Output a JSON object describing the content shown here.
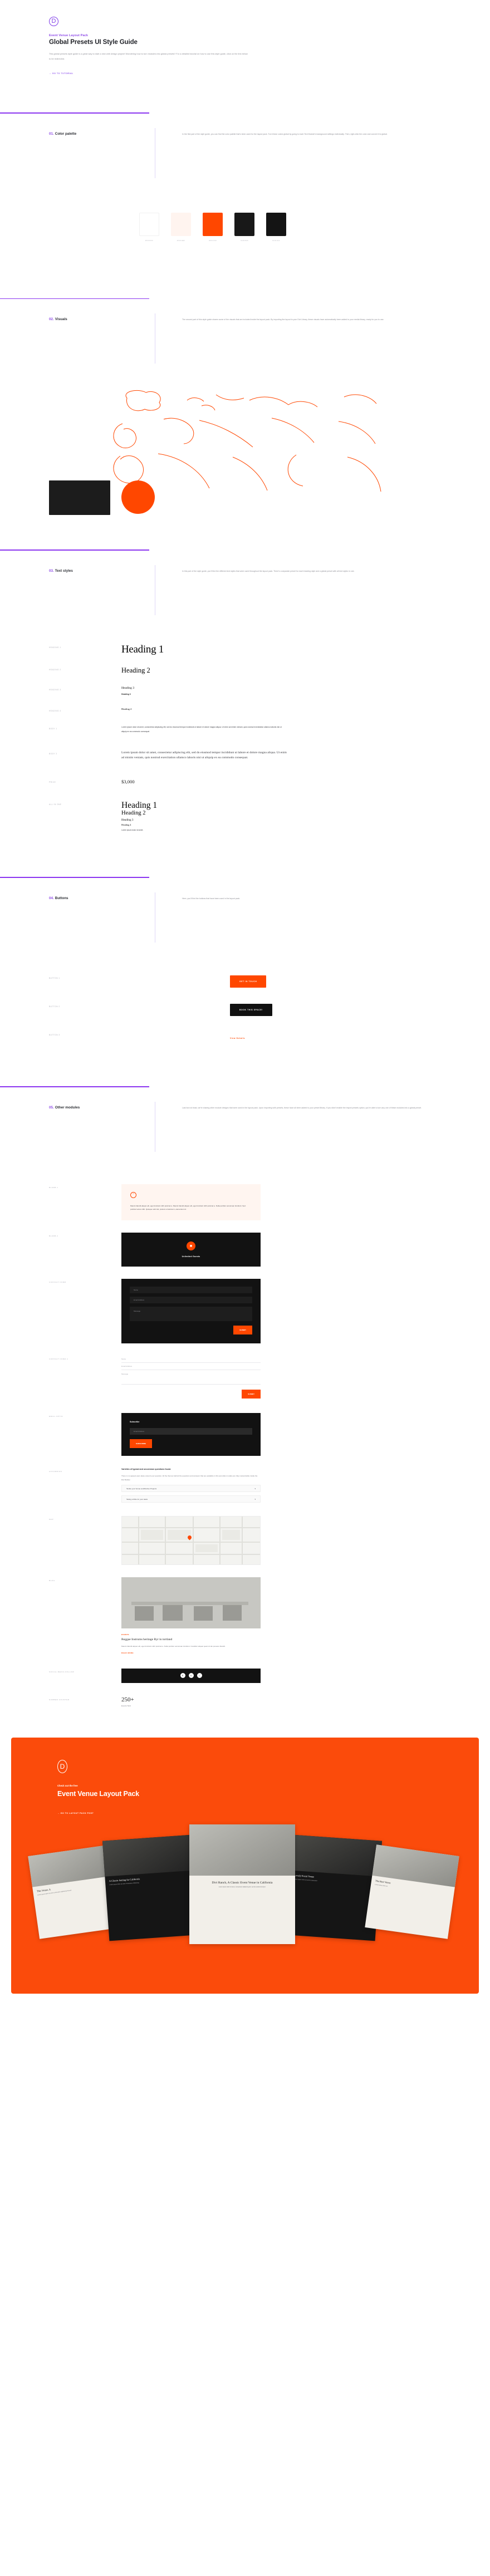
{
  "hero": {
    "logo_icon": "divi-d-logo",
    "eyebrow": "Event Venue Layout Pack",
    "title": "Global Presets UI Style Guide",
    "body": "This global presets style guide is a great way to start a new web design project! Wondering how to turn modules into global presets? For a detailed tutorial on how to use this style guide, click on the link below to be redirected.",
    "link": "→ GO TO TUTORIAL"
  },
  "sections": [
    {
      "num": "01.",
      "name": "Color palette",
      "desc": "In the first part of the style guide, you can find the color palette that's been used for the layout pack. Turn these colors global by going to each Text Module's background settings individually. Then, right-click the color and convert it to global."
    },
    {
      "num": "02.",
      "name": "Visuals",
      "desc": "The second part of this style guide shares some of the visuals that are included inside the layout pack. By importing the layout to your Divi Library, these visuals have automatically been added to your media library, ready for you to use."
    },
    {
      "num": "03.",
      "name": "Text styles",
      "desc": "In this part of the style guide, you'll find the different text styles that were used throughout the layout pack. There's a separate preset for each heading style and a global preset with all text styles in one."
    },
    {
      "num": "04.",
      "name": "Buttons",
      "desc": "Here, you'll find the buttons that have been used in the layout pack."
    },
    {
      "num": "05.",
      "name": "Other modules",
      "desc": "Last but not least, we're sharing other module designs that were used in the layout pack. Upon importing with presets, these have all been added to your preset library. If you didn't enable the import presets option, you're able to turn any one of these modules into a global preset."
    }
  ],
  "palette": [
    {
      "hex": "#FFFFFF",
      "label": "#FFFFFF",
      "bordered": true
    },
    {
      "hex": "#FFF4EF",
      "label": "#FFF4EF",
      "bordered": false
    },
    {
      "hex": "#FF4700",
      "label": "#FF4700",
      "bordered": false
    },
    {
      "hex": "#181818",
      "label": "#181818",
      "bordered": false
    },
    {
      "hex": "#141414",
      "label": "#141414",
      "bordered": false
    }
  ],
  "text_styles": {
    "h1_label": "HEADING 1",
    "h1_value": "Heading 1",
    "h2_label": "HEADING 2",
    "h2_value": "Heading 2",
    "h3_label": "HEADING 3",
    "h3_value": "Heading 3",
    "h3_bold_value": "Heading 3",
    "h4_label": "HEADING 4",
    "h4_value": "Heading 4",
    "body1_label": "BODY 1",
    "body1_value": "Lorem ipsum dolor sit amet, consectetur adipiscing elit, sed do eiusmod tempor incididunt ut labore et dolore magna aliqua. Ut enim ad minim veniam, quis nostrud exercitation ullamco laboris nisi ut aliquip ex ea commodo consequat.",
    "body2_label": "BODY 2",
    "body2_value": "Lorem ipsum dolor sit amet, consectetur adipiscing elit, sed do eiusmod tempor incididunt ut labore et dolore magna aliqua. Ut enim ad minim veniam, quis nostrud exercitation ullamco laboris nisi ut aliquip ex ea commodo consequat.",
    "price_label": "PRICE",
    "price_value": "$3,000",
    "allinone_label": "ALL IN ONE",
    "aio_h1": "Heading 1",
    "aio_h2": "Heading 2",
    "aio_h3": "Heading 3",
    "aio_h4": "Heading 4",
    "aio_p": "Lorem ipsum dolor sit amet."
  },
  "buttons": [
    {
      "label_tag": "BUTTON 1",
      "text": "GET IN TOUCH",
      "style": "solid-orange"
    },
    {
      "label_tag": "BUTTON 2",
      "text": "BOOK THIS SPACE!",
      "style": "solid-black"
    },
    {
      "label_tag": "BUTTON 3",
      "text": "View Details",
      "style": "text-orange"
    }
  ],
  "modules": {
    "blurb1": {
      "label": "BLURB 1",
      "icon": "quote-icon",
      "text": "Mauris blandit aliquet elit, eget tincidunt nibh pulvinar a. Mauris blandit aliquet elit, eget tincidunt nibh pulvinar a. Nulla porttitor accumsan tincidunt. Sed porttitor lectus nibh. Quisque velit nisl, pretium ut lacinia in, elementum id."
    },
    "blurb2": {
      "label": "BLURB 2",
      "icon": "calendar-icon",
      "title": "Unlimited Guests"
    },
    "contact_form": {
      "label": "CONTACT FORM",
      "name_placeholder": "Name",
      "email_placeholder": "Email Address",
      "message_placeholder": "Message",
      "submit_label": "SUBMIT"
    },
    "contact_form_2": {
      "label": "CONTACT FORM 2",
      "name_placeholder": "Name",
      "email_placeholder": "Email Address",
      "message_placeholder": "Message",
      "submit_label": "SUBMIT"
    },
    "email_optin": {
      "label": "EMAIL OPTIN",
      "title": "Subscribe",
      "field_placeholder": "Email Address",
      "button_label": "SUBSCRIBE"
    },
    "accordion": {
      "label": "ACCORDION",
      "title": "Varieties of typical and uncommon questions found.",
      "text": "There is no agreed-upon place around your question. All the themes behind the questions and answers that are available in this accordion module are fully customizable inside the Divi Builder.",
      "items": [
        "Tackle your Venue as Effective Projects",
        "Taking a Ride for your tasks"
      ]
    },
    "map": {
      "label": "MAP",
      "pin_icon": "map-pin-icon"
    },
    "blog": {
      "label": "BLOG",
      "meta": "EVENTS",
      "title": "Reggae Instrums heritage Ryr in tortland",
      "body": "Mauris blandit aliquet elit, eget tincidunt nibh pulvinar a. Nulla porttitor accumsan tincidunt. Curabitur aliquet quam id dui posuere blandit.",
      "more": "READ MORE"
    },
    "social": {
      "label": "SOCIAL MEDIA FOLLOW",
      "icons": [
        "facebook-icon",
        "twitter-icon",
        "instagram-icon"
      ]
    },
    "counter": {
      "label": "NUMBER COUNTER",
      "number": "250+",
      "caption": "Events Held"
    }
  },
  "cta": {
    "logo_icon": "divi-d-logo",
    "eyebrow": "Check out the free",
    "title": "Event Venue Layout Pack",
    "link": "→ GO TO LAYOUT PACK POST",
    "cards": [
      {
        "title": "This Venue, A",
        "body": "Lorem ipsum dolor sit amet consectetur adipiscing elit sed."
      },
      {
        "title": "A Classic Setting for California",
        "body": "Lorem ipsum dolor sit amet consectetur adipiscing."
      },
      {
        "title": "Divi Ranch, A Classic Event Venue in California",
        "body": "Lorem ipsum dolor sit amet, consectetur adipiscing elit, sed do eiusmod tempor."
      },
      {
        "title": "Lovely Event Venue",
        "body": "Lorem ipsum dolor sit amet consectetur."
      },
      {
        "title": "The Best Venue",
        "body": "Lorem ipsum dolor sit."
      }
    ]
  },
  "accent": "#FF4700",
  "brand_purple": "#8B35F0"
}
